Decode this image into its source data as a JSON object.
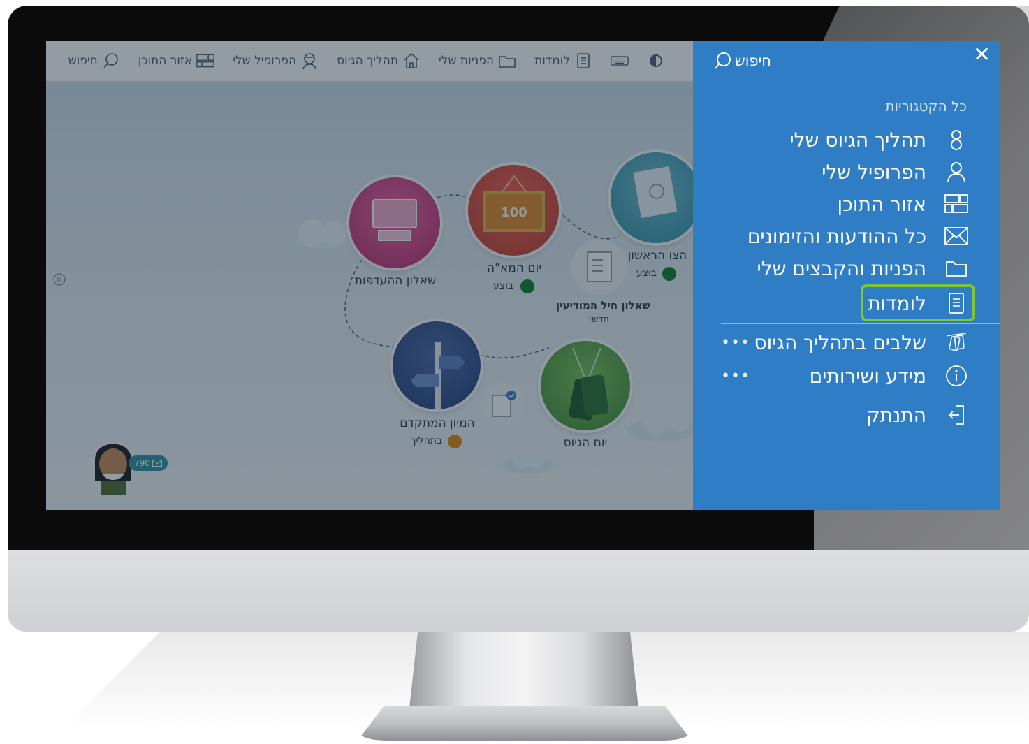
{
  "topbar": {
    "items": [
      {
        "label": "חיפוש",
        "icon": "search-icon"
      },
      {
        "label": "אזור התוכן",
        "icon": "content-area-icon"
      },
      {
        "label": "הפרופיל שלי",
        "icon": "soldier-profile-icon"
      },
      {
        "label": "תהליך הגיוס",
        "icon": "home-icon"
      },
      {
        "label": "הפניות שלי",
        "icon": "folder-icon"
      },
      {
        "label": "לומדות",
        "icon": "book-icon"
      },
      {
        "label": "",
        "icon": "keyboard-icon"
      },
      {
        "label": "",
        "icon": "contrast-icon"
      }
    ]
  },
  "map": {
    "nodes": [
      {
        "label": "שאלון ההעדפות",
        "status": ""
      },
      {
        "label": "יום המא\"ה",
        "status": "בוצע"
      },
      {
        "label": "הצו הראשון",
        "status": "בוצע"
      },
      {
        "label": "שאלון חיל המודיעין",
        "status": "חדש!"
      },
      {
        "label": "המיון המתקדם",
        "status": "בתהליך"
      },
      {
        "label": "יום הגיוס",
        "status": ""
      }
    ],
    "board_text": "100",
    "message_count": "790",
    "status_colors": {
      "done": "#0e7f2e",
      "in_progress": "#e08a10"
    }
  },
  "menu": {
    "close_label": "✕",
    "search_label": "חיפוש",
    "categories_label": "כל הקטגוריות",
    "items": [
      {
        "label": "תהליך הגיוס שלי",
        "icon": "process-icon"
      },
      {
        "label": "הפרופיל שלי",
        "icon": "user-icon"
      },
      {
        "label": "אזור התוכן",
        "icon": "content-area-icon"
      },
      {
        "label": "כל ההודעות והזימונים",
        "icon": "envelope-icon"
      },
      {
        "label": "הפניות והקבצים שלי",
        "icon": "folder-icon"
      },
      {
        "label": "לומדות",
        "icon": "book-icon",
        "highlighted": true
      },
      {
        "label": "שלבים בתהליך הגיוס",
        "icon": "dogtag-icon",
        "more": "•••"
      },
      {
        "label": "מידע ושירותים",
        "icon": "info-icon",
        "more": "•••"
      },
      {
        "label": "התנתק",
        "icon": "logout-icon"
      }
    ],
    "colors": {
      "background": "#2f7ec5",
      "highlight": "#7ec636"
    }
  }
}
